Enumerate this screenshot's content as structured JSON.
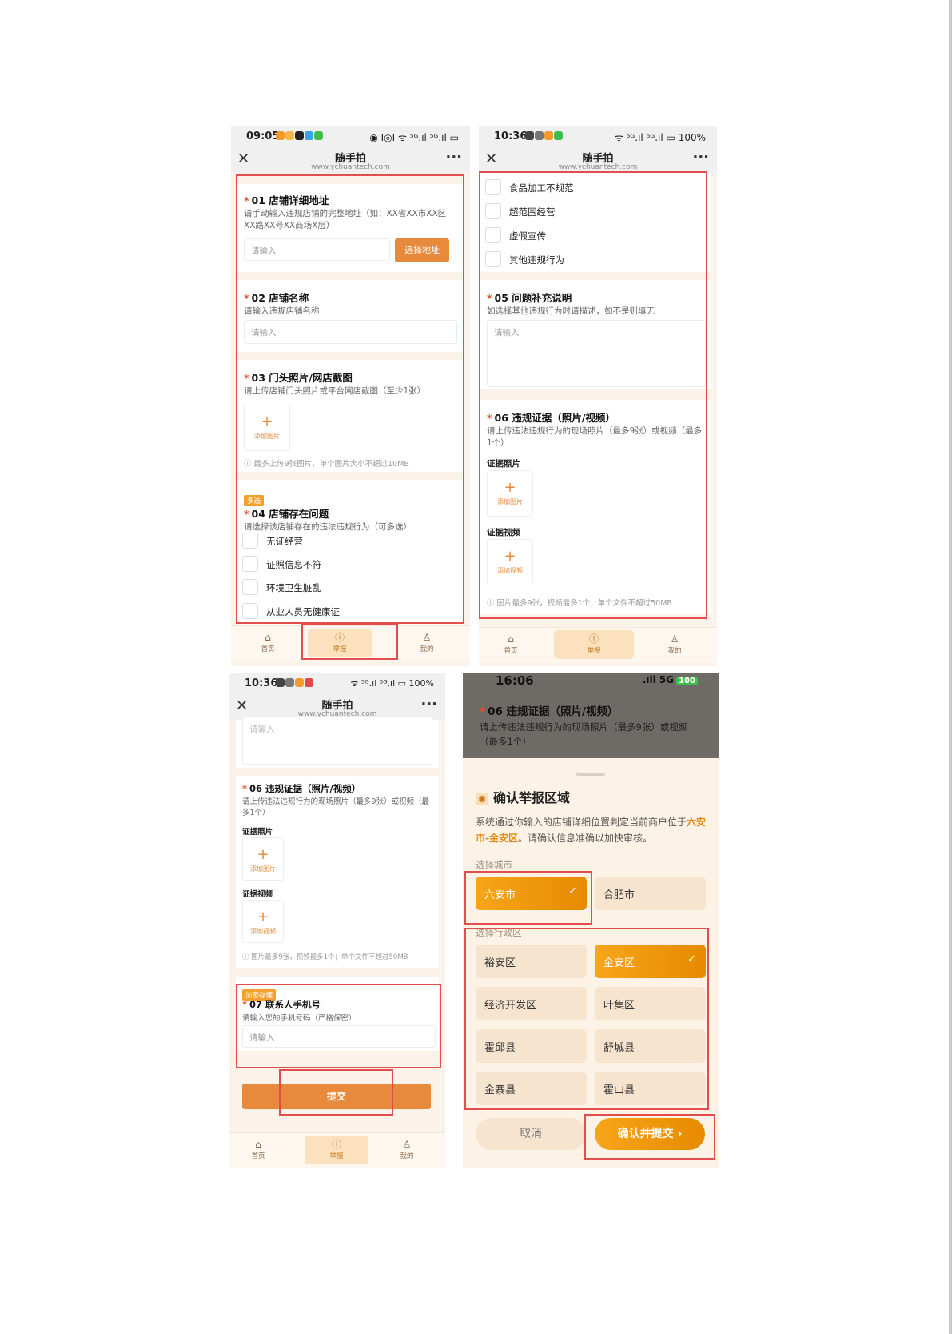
{
  "app": {
    "title": "随手拍",
    "url": "www.ychuantech.com",
    "close_glyph": "✕",
    "more_glyph": "···"
  },
  "status": {
    "p1_time": "09:05",
    "p1_right": "◉ I◎I ᯤ ⁵ᴳ.ıl ⁵ᴳ.ıl ▭",
    "p2_time": "10:36",
    "p2_right": "ᯤ ⁵ᴳ.ıl ⁵ᴳ.ıl ▭ 100%",
    "p3_time": "10:36",
    "p3_right": "ᯤ ⁵ᴳ.ıl ⁵ᴳ.ıl ▭ 100%",
    "p4_time": "16:06",
    "p4_signal": ".ıll 5G",
    "p4_battery": "100"
  },
  "form": {
    "required_mark": "*",
    "q01": {
      "title": "01 店铺详细地址",
      "hint": "请手动输入违规店铺的完整地址（如：XX省XX市XX区XX路XX号XX商场X层）",
      "placeholder": "请输入",
      "button": "选择地址"
    },
    "q02": {
      "title": "02 店铺名称",
      "hint": "请输入违规店铺名称",
      "placeholder": "请输入"
    },
    "q03": {
      "title": "03 门头照片/网店截图",
      "hint": "请上传店铺门头照片或平台网店截图（至少1张）",
      "upload_label": "添加图片",
      "note": "ⓘ 最多上传9张图片，单个图片大小不超过10MB"
    },
    "q04": {
      "tag": "多选",
      "title": "04 店铺存在问题",
      "hint": "请选择该店铺存在的违法违规行为（可多选）",
      "options": [
        "无证经营",
        "证照信息不符",
        "环境卫生脏乱",
        "从业人员无健康证",
        "食品加工不规范",
        "超范围经营",
        "虚假宣传",
        "其他违规行为"
      ]
    },
    "q05": {
      "title": "05 问题补充说明",
      "hint": "如选择其他违规行为时请描述，如不是则填无",
      "placeholder": "请输入"
    },
    "q06": {
      "title": "06 违规证据（照片/视频）",
      "hint": "请上传违法违规行为的现场照片（最多9张）或视频（最多1个）",
      "photo_label": "证据照片",
      "photo_upload": "添加图片",
      "video_label": "证据视频",
      "video_upload": "添加视频",
      "note": "ⓘ 图片最多9张，视频最多1个；单个文件不超过50MB"
    },
    "q07": {
      "tag": "加密存储",
      "title": "07 联系人手机号",
      "hint": "请输入您的手机号码（严格保密）",
      "placeholder": "请输入"
    },
    "submit": "提交",
    "cut_text": "请输入"
  },
  "tabbar": {
    "home": "首页",
    "report": "举报",
    "mine": "我的",
    "home_icon": "⌂",
    "report_icon": "ⓘ",
    "mine_icon": "♙"
  },
  "sheet": {
    "title": "确认举报区域",
    "pin_icon": "◉",
    "desc_prefix": "系统通过你输入的店铺详细位置判定当前商户位于",
    "desc_highlight": "六安市-金安区",
    "desc_suffix": "。请确认信息准确以加快审核。",
    "city_label": "选择城市",
    "cities": [
      "六安市",
      "合肥市"
    ],
    "selected_city": "六安市",
    "district_label": "选择行政区",
    "districts": [
      "裕安区",
      "金安区",
      "经济开发区",
      "叶集区",
      "霍邱县",
      "舒城县",
      "金寨县",
      "霍山县"
    ],
    "selected_district": "金安区",
    "check_glyph": "✓",
    "cancel": "取消",
    "confirm": "确认并提交 ›"
  },
  "colors": {
    "accent": "#e88a3c",
    "highlight_box": "#e24d4d",
    "required": "#e8502f",
    "selected_gradient_start": "#f7a51a"
  }
}
